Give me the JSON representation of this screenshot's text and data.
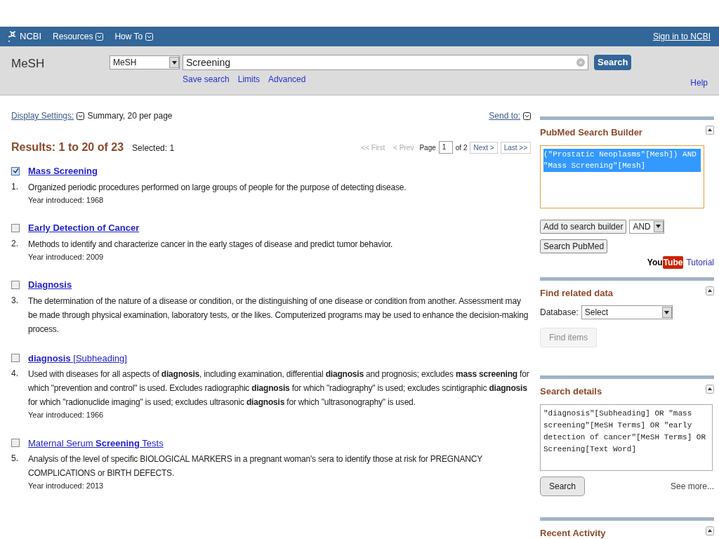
{
  "topbar": {
    "logo": "NCBI",
    "menus": [
      "Resources",
      "How To"
    ],
    "signin": "Sign in to NCBI"
  },
  "search_bar": {
    "db_label": "MeSH",
    "db_select": "MeSH",
    "query": "Screening",
    "button": "Search",
    "links": [
      "Save search",
      "Limits",
      "Advanced"
    ],
    "help": "Help"
  },
  "display": {
    "label": "Display Settings:",
    "value": "Summary, 20 per page",
    "send_to": "Send to:"
  },
  "results_header": {
    "count": "Results: 1 to 20 of 23",
    "selected": "Selected: 1"
  },
  "pager": {
    "first": {
      "label": "<< First",
      "disabled": true
    },
    "prev": {
      "label": "< Prev",
      "disabled": true
    },
    "page_label": "Page",
    "page": "1",
    "of": "of 2",
    "next": {
      "label": "Next >",
      "disabled": false
    },
    "last": {
      "label": "Last >>",
      "disabled": false
    }
  },
  "results": [
    {
      "number": "1.",
      "title": "Mass Screening",
      "title_bold": true,
      "checked": true,
      "description": "Organized periodic procedures performed on large groups of people for the purpose of detecting disease.",
      "year": "Year introduced: 1968"
    },
    {
      "number": "2.",
      "title": "Early Detection of Cancer",
      "title_bold": true,
      "checked": false,
      "description": "Methods to identify and characterize cancer in the early stages of disease and predict tumor behavior.",
      "year": "Year introduced: 2009"
    },
    {
      "number": "3.",
      "title": "Diagnosis",
      "title_bold": true,
      "checked": false,
      "description": "The determination of the nature of a disease or condition, or the distinguishing of one disease or condition from another. Assessment may be made through physical examination, laboratory tests, or the likes. Computerized programs may be used to enhance the decision-making process."
    },
    {
      "number": "4.",
      "title": "**diagnosis** [Subheading]",
      "title_bold": false,
      "checked": false,
      "description": "Used with diseases for all aspects of **diagnosis**, including examination, differential **diagnosis** and prognosis; excludes **mass screening** for which \"prevention and control\" is used. Excludes radiographic **diagnosis** for which \"radiography\" is used; excludes scintigraphic **diagnosis** for which \"radionuclide imaging\" is used; excludes ultrasonic **diagnosis** for which \"ultrasonography\" is used.",
      "year": "Year introduced: 1966"
    },
    {
      "number": "5.",
      "title": "Maternal Serum **Screening** Tests",
      "title_bold": false,
      "checked": false,
      "description": "Analysis of the level of specific BIOLOGICAL MARKERS in a pregnant woman's sera to identify those at risk for PREGNANCY COMPLICATIONS or BIRTH DEFECTS.",
      "year": "Year introduced: 2013"
    }
  ],
  "sidebar": {
    "builder": {
      "title": "PubMed Search Builder",
      "query": "(\"Prostatic Neoplasms\"[Mesh]) AND \"Mass Screening\"[Mesh]",
      "add_button": "Add to search builder",
      "operator": "AND",
      "search_button": "Search PubMed",
      "youtube": [
        "You",
        "Tube"
      ],
      "tutorial": "Tutorial"
    },
    "related": {
      "title": "Find related data",
      "db_label": "Database:",
      "db_select": "Select",
      "find_button": {
        "label": "Find items",
        "disabled": true
      }
    },
    "details": {
      "title": "Search details",
      "query": "\"diagnosis\"[Subheading] OR \"mass screening\"[MeSH Terms] OR \"early detection of cancer\"[MeSH Terms] OR Screening[Text Word]",
      "search_button": "Search",
      "see_more": "See more..."
    },
    "recent": {
      "title": "Recent Activity"
    }
  }
}
